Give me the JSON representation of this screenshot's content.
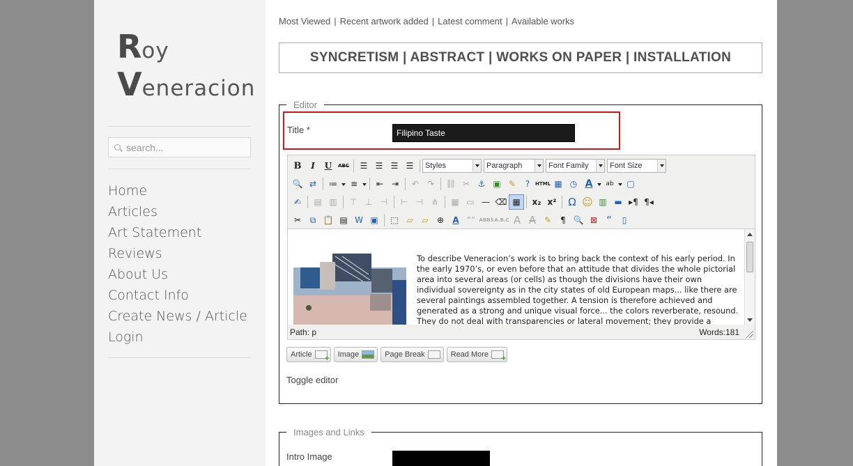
{
  "logo": {
    "first_cap": "R",
    "first_rest": "oy",
    "last_cap": "V",
    "last_rest": "eneracion"
  },
  "search": {
    "placeholder": "search..."
  },
  "nav": {
    "items": [
      "Home",
      "Articles",
      "Art Statement",
      "Reviews",
      "About Us",
      "Contact Info",
      "Create News / Article",
      "Login"
    ]
  },
  "topnav": {
    "items": [
      "Most Viewed",
      "Recent artwork added",
      "Latest comment",
      "Available works"
    ],
    "separator": "|"
  },
  "banner": {
    "text": "SYNCRETISM | ABSTRACT | WORKS ON PAPER | INSTALLATION"
  },
  "editor": {
    "legend": "Editor",
    "title_label": "Title *",
    "title_value": "Filipino Taste",
    "dropdowns": [
      "Styles",
      "Paragraph",
      "Font Family",
      "Font Size"
    ],
    "body_text": "To describe Veneracion’s work is to bring back the context of his early period. In the early 1970’s, or even before that an attitude that divides the whole pictorial area into several areas (or cells) as though the divisions have their own individual sovereignty as in the city states of old European maps... like there are several paintings assembled together. A tension is therefore achieved and generated as a strong and unique visual force... the colors reverberate, resound. They do not deal with transparencies or lateral movement; they provide a frenzied structure built",
    "path": "Path: p",
    "words": "Words:181",
    "buttons": [
      "Article",
      "Image",
      "Page Break",
      "Read More"
    ],
    "toggle": "Toggle editor"
  },
  "images_links": {
    "legend": "Images and Links",
    "intro_label": "Intro Image"
  },
  "colors": {
    "title_highlight": "#d4141c",
    "sidebar_bg": "#f3f3f3",
    "outer_bg": "#8c8c8c"
  }
}
